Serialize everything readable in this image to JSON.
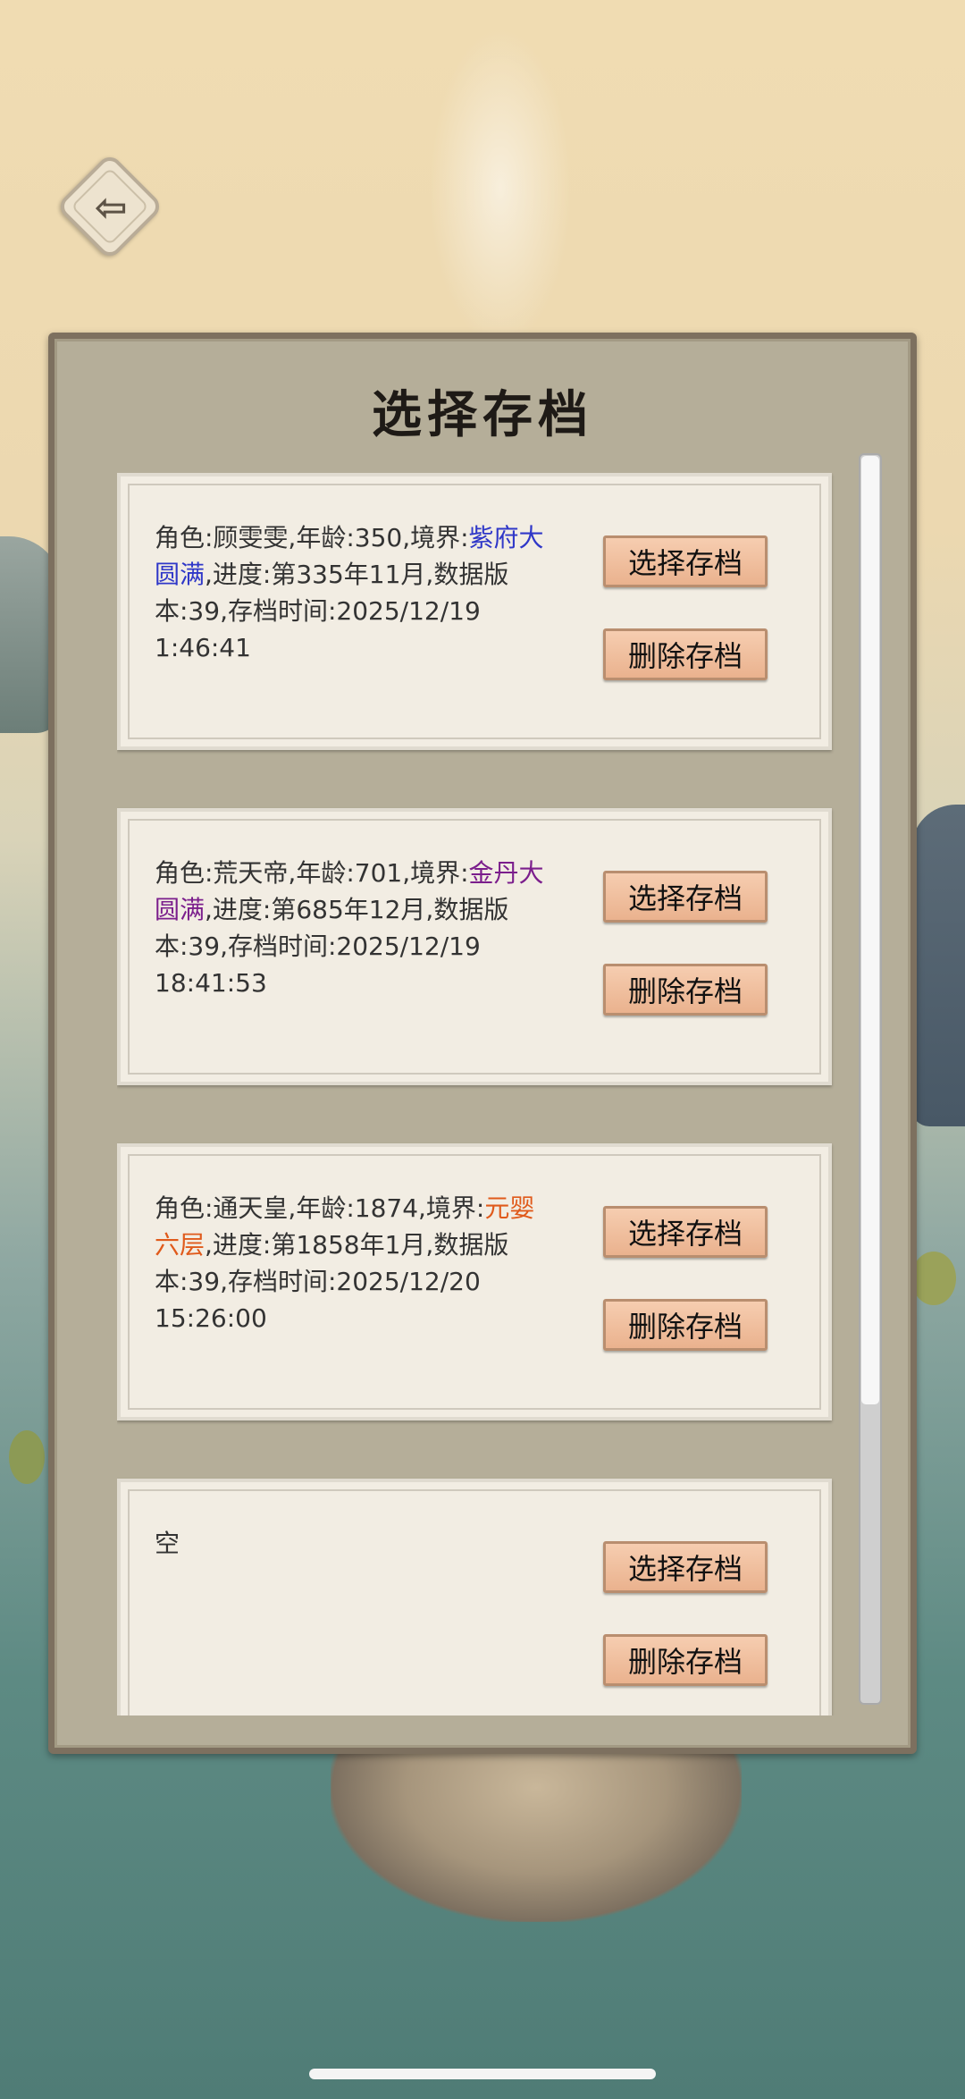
{
  "screen": {
    "title": "选择存档",
    "back_icon": "back-arrow-icon"
  },
  "slots": [
    {
      "desc_prefix": "角色:顾雯雯,年龄:350,境界:",
      "realm": "紫府大圆满",
      "realm_color": "#2f37c8",
      "desc_suffix": ",进度:第335年11月,数据版本:39,存档时间:2025/12/19 1:46:41",
      "select_label": "选择存档",
      "delete_label": "删除存档"
    },
    {
      "desc_prefix": "角色:荒天帝,年龄:701,境界:",
      "realm": "金丹大圆满",
      "realm_color": "#7b1e8c",
      "desc_suffix": ",进度:第685年12月,数据版本:39,存档时间:2025/12/19 18:41:53",
      "select_label": "选择存档",
      "delete_label": "删除存档"
    },
    {
      "desc_prefix": "角色:通天皇,年龄:1874,境界:",
      "realm": "元婴六层",
      "realm_color": "#e05a1b",
      "desc_suffix": ",进度:第1858年1月,数据版本:39,存档时间:2025/12/20 15:26:00",
      "select_label": "选择存档",
      "delete_label": "删除存档"
    },
    {
      "desc_prefix": "空",
      "realm": "",
      "desc_suffix": "",
      "select_label": "选择存档",
      "delete_label": "删除存档"
    }
  ],
  "scroll": {
    "visible_fraction": 0.76
  }
}
